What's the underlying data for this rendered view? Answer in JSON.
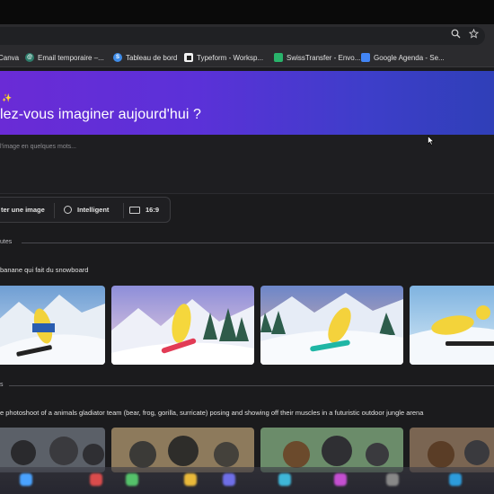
{
  "browser": {
    "toolbar_icons": [
      "zoom-icon",
      "star-icon"
    ],
    "bookmarks": [
      {
        "label": "Canva",
        "icon": "canva-icon",
        "color": "#00c4cc"
      },
      {
        "label": "Email temporaire –...",
        "icon": "email-icon",
        "color": "#2e7d6b"
      },
      {
        "label": "Tableau de bord",
        "icon": "s-icon",
        "color": "#3f8ce8"
      },
      {
        "label": "Typeform - Worksp...",
        "icon": "typeform-icon",
        "color": "#f2f2f2"
      },
      {
        "label": "SwissTransfer - Envo...",
        "icon": "swisstransfer-icon",
        "color": "#29b36b"
      },
      {
        "label": "Google Agenda - Se...",
        "icon": "calendar-icon",
        "color": "#4285f4"
      }
    ]
  },
  "hero": {
    "sparkle": "✨",
    "title": "lez-vous imaginer aujourd'hui ?"
  },
  "prompt": {
    "placeholder": "l'image en quelques mots..."
  },
  "options": {
    "add_image": "ter une image",
    "style": "Intelligent",
    "ratio": "16:9"
  },
  "sections": [
    {
      "label": "utes",
      "prompt": "banane qui fait du snowboard"
    },
    {
      "label": "s",
      "prompt": "e photoshoot of a animals gladiator team (bear, frog, gorilla, surricate) posing and showing off their muscles in a futuristic outdoor jungle arena"
    }
  ],
  "colors": {
    "hero_start": "#6a2bd6",
    "hero_end": "#2f3fb8",
    "background": "#1b1b1d"
  }
}
